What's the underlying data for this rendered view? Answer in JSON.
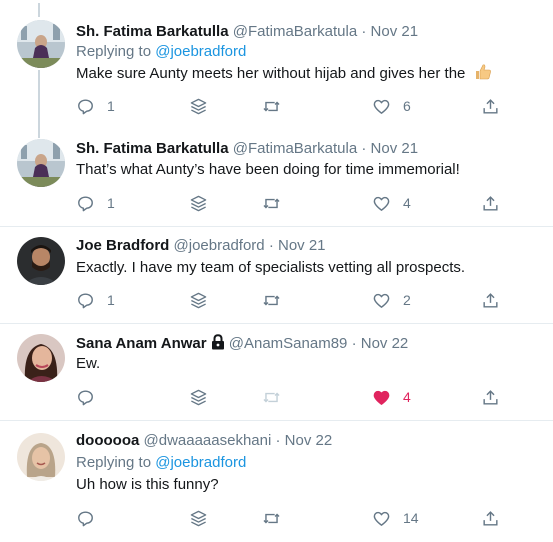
{
  "tweets": [
    {
      "name": "Sh. Fatima Barkatulla",
      "handle": "@FatimaBarkatula",
      "sep": "·",
      "date": "Nov 21",
      "reply_prefix": "Replying to ",
      "reply_to": "@joebradford",
      "text": "Make sure Aunty meets her without hijab and gives her the",
      "emoji": "thumbs-up",
      "replies": "1",
      "likes": "6",
      "liked": false
    },
    {
      "name": "Sh. Fatima Barkatulla",
      "handle": "@FatimaBarkatula",
      "sep": "·",
      "date": "Nov 21",
      "text": "That’s what Aunty’s have been doing for time immemorial!",
      "replies": "1",
      "likes": "4",
      "liked": false
    },
    {
      "name": "Joe Bradford",
      "handle": "@joebradford",
      "sep": "·",
      "date": "Nov 21",
      "text": "Exactly. I have my team of specialists vetting all prospects.",
      "replies": "1",
      "likes": "2",
      "liked": false
    },
    {
      "name": "Sana Anam Anwar",
      "protected": true,
      "handle": "@AnamSanam89",
      "sep": "·",
      "date": "Nov 22",
      "text": "Ew.",
      "replies": "",
      "likes": "4",
      "liked": true
    },
    {
      "name": "doooooa",
      "handle": "@dwaaaaasekhani",
      "sep": "·",
      "date": "Nov 22",
      "reply_prefix": "Replying to ",
      "reply_to": "@joebradford",
      "text": "Uh how is this funny?",
      "replies": "",
      "likes": "14",
      "liked": false
    }
  ],
  "colors": {
    "accent": "#1b95e0",
    "muted": "#657786",
    "like_active": "#e0245e",
    "thread_line": "#ccd6dd"
  }
}
